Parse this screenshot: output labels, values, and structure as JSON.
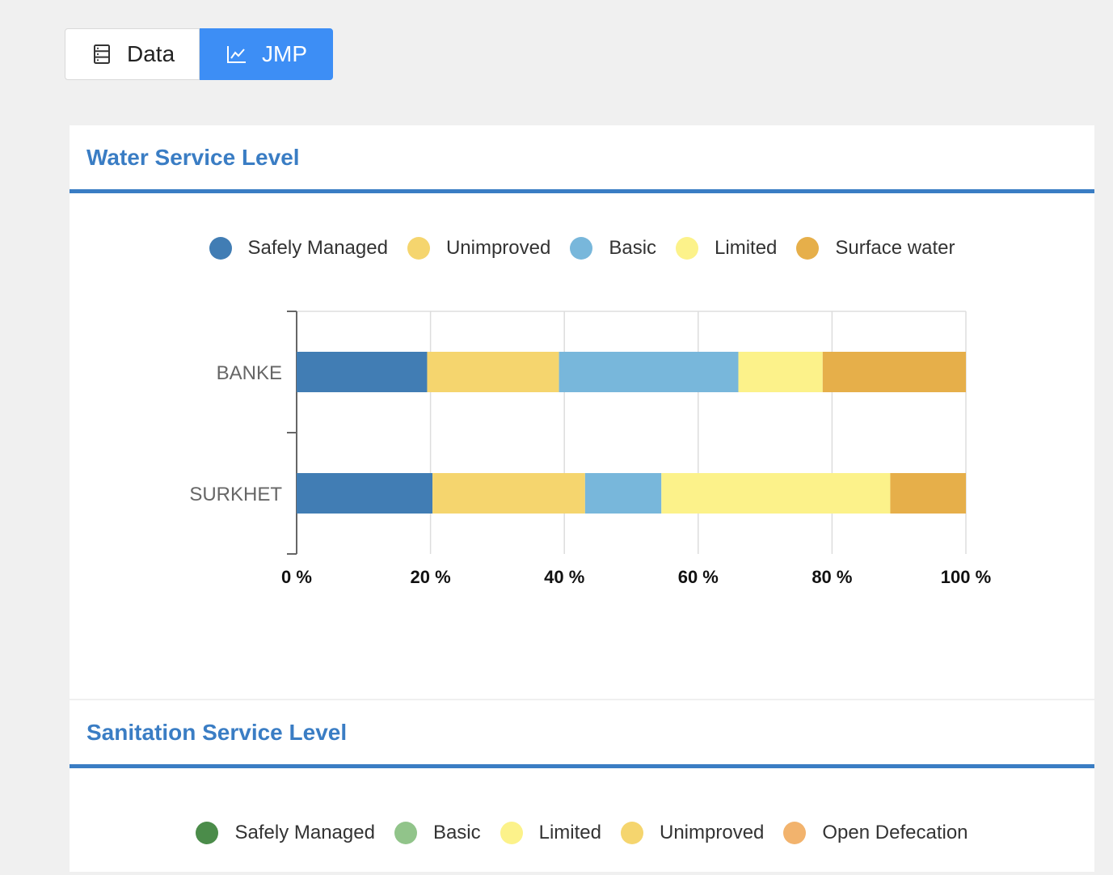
{
  "tabs": {
    "data_label": "Data",
    "jmp_label": "JMP"
  },
  "water": {
    "title": "Water Service Level",
    "legend": [
      {
        "label": "Safely Managed",
        "color": "#417db4"
      },
      {
        "label": "Unimproved",
        "color": "#f5d56e"
      },
      {
        "label": "Basic",
        "color": "#78b7db"
      },
      {
        "label": "Limited",
        "color": "#fcf28a"
      },
      {
        "label": "Surface water",
        "color": "#e6af4a"
      }
    ]
  },
  "sanitation": {
    "title": "Sanitation Service Level",
    "legend": [
      {
        "label": "Safely Managed",
        "color": "#4b8c4a"
      },
      {
        "label": "Basic",
        "color": "#91c48a"
      },
      {
        "label": "Limited",
        "color": "#fcf28a"
      },
      {
        "label": "Unimproved",
        "color": "#f5d56e"
      },
      {
        "label": "Open Defecation",
        "color": "#f2b36d"
      }
    ]
  },
  "chart_data": {
    "type": "bar",
    "orientation": "horizontal",
    "stacked": true,
    "categories": [
      "BANKE",
      "SURKHET"
    ],
    "series": [
      {
        "name": "Safely Managed",
        "color": "#417db4",
        "values": [
          19.5,
          20.3
        ]
      },
      {
        "name": "Unimproved",
        "color": "#f5d56e",
        "values": [
          19.7,
          22.8
        ]
      },
      {
        "name": "Basic",
        "color": "#78b7db",
        "values": [
          26.8,
          11.4
        ]
      },
      {
        "name": "Limited",
        "color": "#fcf28a",
        "values": [
          12.6,
          34.2
        ]
      },
      {
        "name": "Surface water",
        "color": "#e6af4a",
        "values": [
          21.4,
          11.3
        ]
      }
    ],
    "xlim": [
      0,
      100
    ],
    "xticks": [
      "0 %",
      "20 %",
      "40 %",
      "60 %",
      "80 %",
      "100 %"
    ],
    "grid": true
  }
}
